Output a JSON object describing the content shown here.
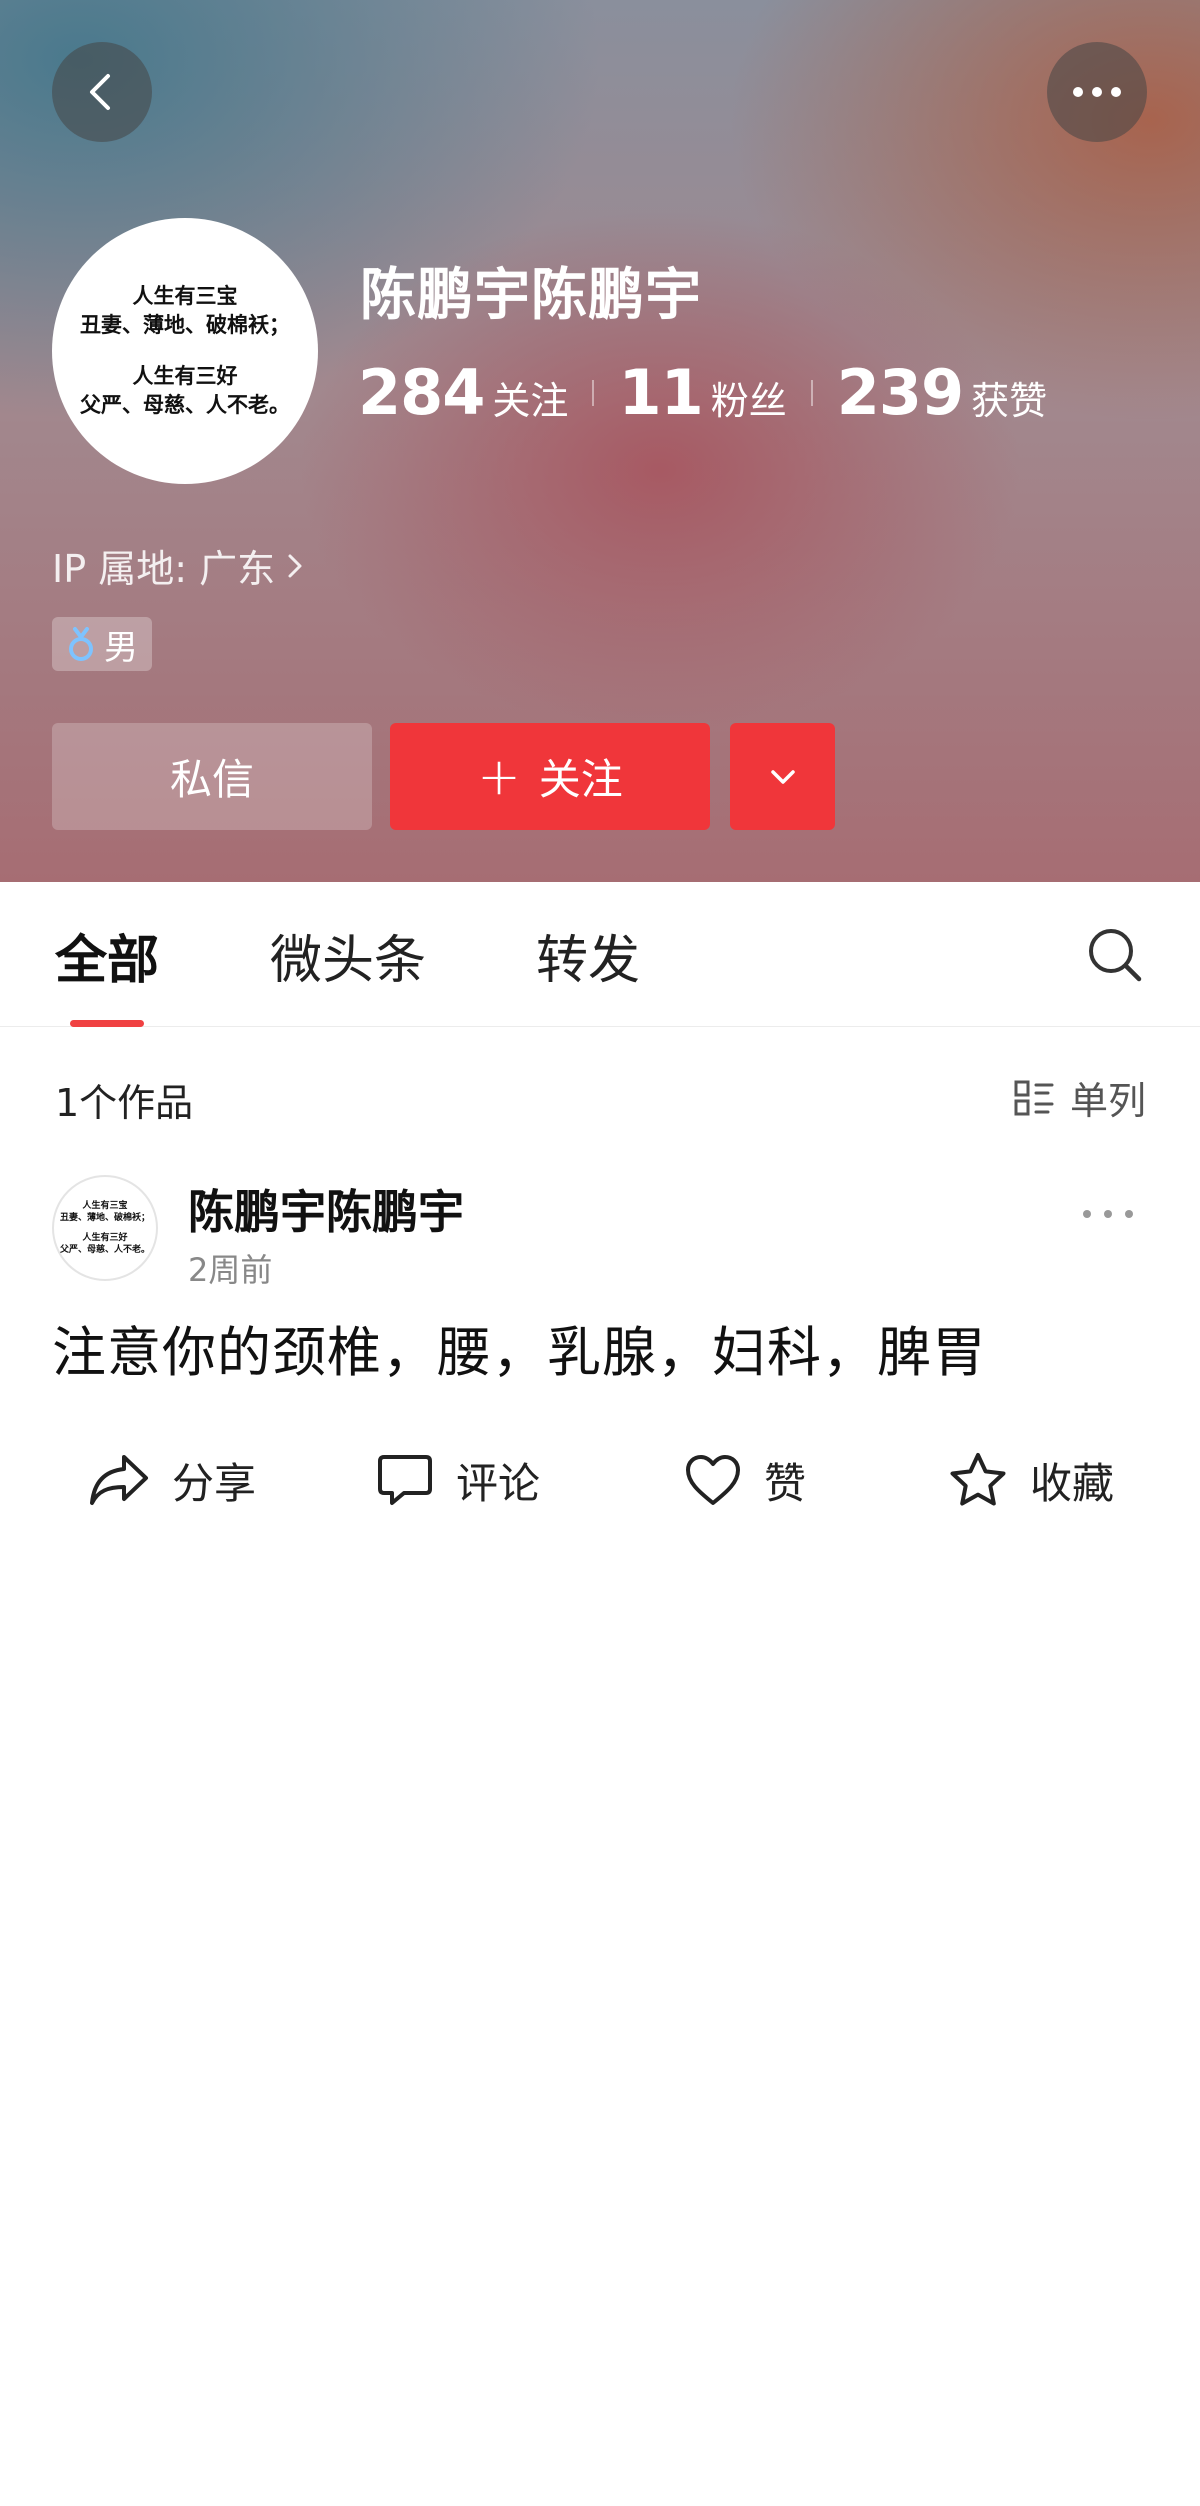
{
  "header": {
    "back_icon": "chevron-left-icon",
    "more_icon": "more-horizontal-icon",
    "avatar_text": {
      "line1": "人生有三宝",
      "line2": "丑妻、薄地、破棉袄；",
      "line3": "人生有三好",
      "line4": "父严、母慈、人不老。"
    },
    "username": "陈鹏宇陈鹏宇",
    "stats": {
      "following_count": "284",
      "following_label": "关注",
      "fans_count": "11",
      "fans_label": "粉丝",
      "likes_count": "239",
      "likes_label": "获赞"
    },
    "ip_location": "IP 属地: 广东",
    "gender": "男",
    "buttons": {
      "message": "私信",
      "follow": "关注",
      "follow_plus": "+"
    }
  },
  "tabs": {
    "items": [
      {
        "label": "全部",
        "active": true
      },
      {
        "label": "微头条",
        "active": false
      },
      {
        "label": "转发",
        "active": false
      }
    ],
    "search_icon": "search-icon"
  },
  "list": {
    "works_count": "1个作品",
    "view_mode": "单列"
  },
  "post": {
    "author": "陈鹏宇陈鹏宇",
    "time": "2周前",
    "text": "注意你的颈椎，腰，乳腺，妇科，脾胃",
    "actions": {
      "share": "分享",
      "comment": "评论",
      "like": "赞",
      "favorite": "收藏"
    }
  },
  "colors": {
    "accent_red": "#f0363a",
    "tab_underline": "#f04142"
  }
}
